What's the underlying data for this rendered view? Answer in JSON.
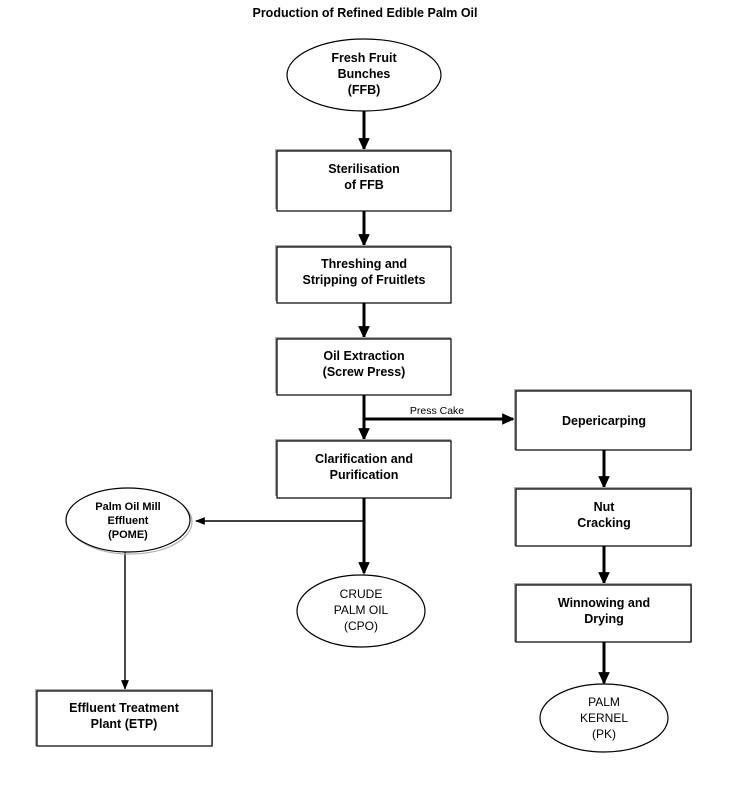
{
  "diagram": {
    "title": "Production of Refined Edible Palm Oil",
    "nodes": {
      "ffb": {
        "shape": "ellipse",
        "lines": [
          "Fresh Fruit",
          "Bunches",
          "(FFB)"
        ]
      },
      "steril": {
        "shape": "rect",
        "lines": [
          "Sterilisation",
          "of FFB"
        ]
      },
      "thresh": {
        "shape": "rect",
        "lines": [
          "Threshing and",
          "Stripping of Fruitlets"
        ]
      },
      "extract": {
        "shape": "rect",
        "lines": [
          "Oil Extraction",
          "(Screw Press)"
        ]
      },
      "clarify": {
        "shape": "rect",
        "lines": [
          "Clarification and",
          "Purification"
        ]
      },
      "pome": {
        "shape": "ellipse",
        "lines": [
          "Palm Oil Mill",
          "Effluent",
          "(POME)"
        ]
      },
      "cpo": {
        "shape": "ellipse",
        "lines": [
          "CRUDE",
          "PALM OIL",
          "(CPO)"
        ]
      },
      "etp": {
        "shape": "rect",
        "lines": [
          "Effluent Treatment",
          "Plant (ETP)"
        ]
      },
      "deperi": {
        "shape": "rect",
        "lines": [
          "Depericarping"
        ]
      },
      "nutcrk": {
        "shape": "rect",
        "lines": [
          "Nut",
          "Cracking"
        ]
      },
      "winnow": {
        "shape": "rect",
        "lines": [
          "Winnowing and",
          "Drying"
        ]
      },
      "pk": {
        "shape": "ellipse",
        "lines": [
          "PALM",
          "KERNEL",
          "(PK)"
        ]
      }
    },
    "edge_labels": {
      "press_cake": "Press Cake"
    },
    "colors": {
      "stroke": "#000000",
      "shadow": "#a8a8a8",
      "background": "#ffffff"
    }
  }
}
